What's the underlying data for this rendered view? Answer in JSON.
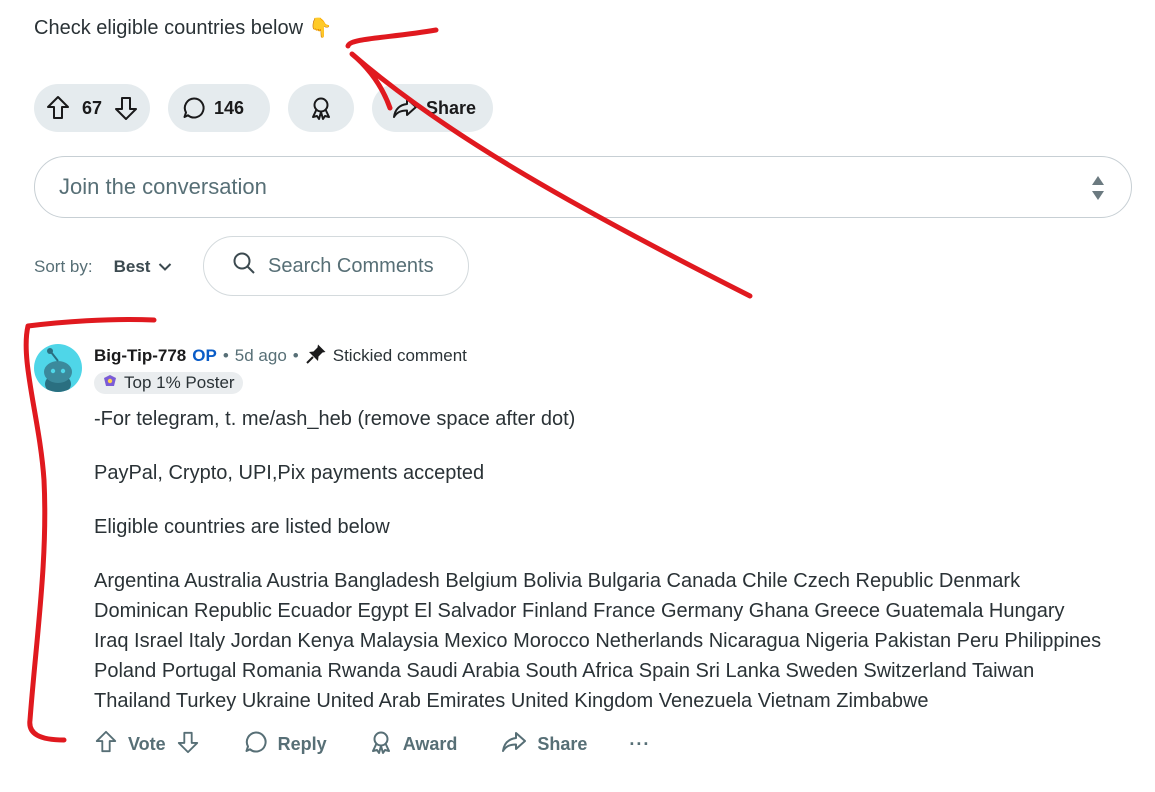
{
  "post": {
    "text": "Check eligible countries below",
    "emoji": "👇",
    "votes": "67",
    "comments": "146",
    "share_label": "Share"
  },
  "composer": {
    "placeholder": "Join the conversation"
  },
  "sort": {
    "label": "Sort by:",
    "value": "Best",
    "search_placeholder": "Search Comments"
  },
  "comment": {
    "author": "Big-Tip-778",
    "op_badge": "OP",
    "time": "5d ago",
    "stickied": "Stickied comment",
    "flair": "Top 1% Poster",
    "paragraphs": [
      "-For telegram, t. me/ash_heb (remove space after dot)",
      "PayPal, Crypto, UPI,Pix payments accepted",
      "Eligible countries are listed below",
      "Argentina Australia Austria Bangladesh Belgium Bolivia Bulgaria Canada Chile Czech Republic Denmark Dominican Republic Ecuador Egypt El Salvador Finland France Germany Ghana Greece Guatemala Hungary Iraq Israel Italy Jordan Kenya Malaysia Mexico Morocco Netherlands Nicaragua Nigeria Pakistan Peru Philippines Poland Portugal Romania Rwanda Saudi Arabia South Africa Spain Sri Lanka Sweden Switzerland Taiwan Thailand Turkey Ukraine United Arab Emirates United Kingdom Venezuela Vietnam Zimbabwe"
    ],
    "actions": {
      "vote": "Vote",
      "reply": "Reply",
      "award": "Award",
      "share": "Share",
      "more": "···"
    }
  },
  "colors": {
    "pill_bg": "#e5ebee",
    "op_blue": "#0a5cc7",
    "annotation_red": "#e0191f",
    "avatar": "#4fd6e8"
  }
}
